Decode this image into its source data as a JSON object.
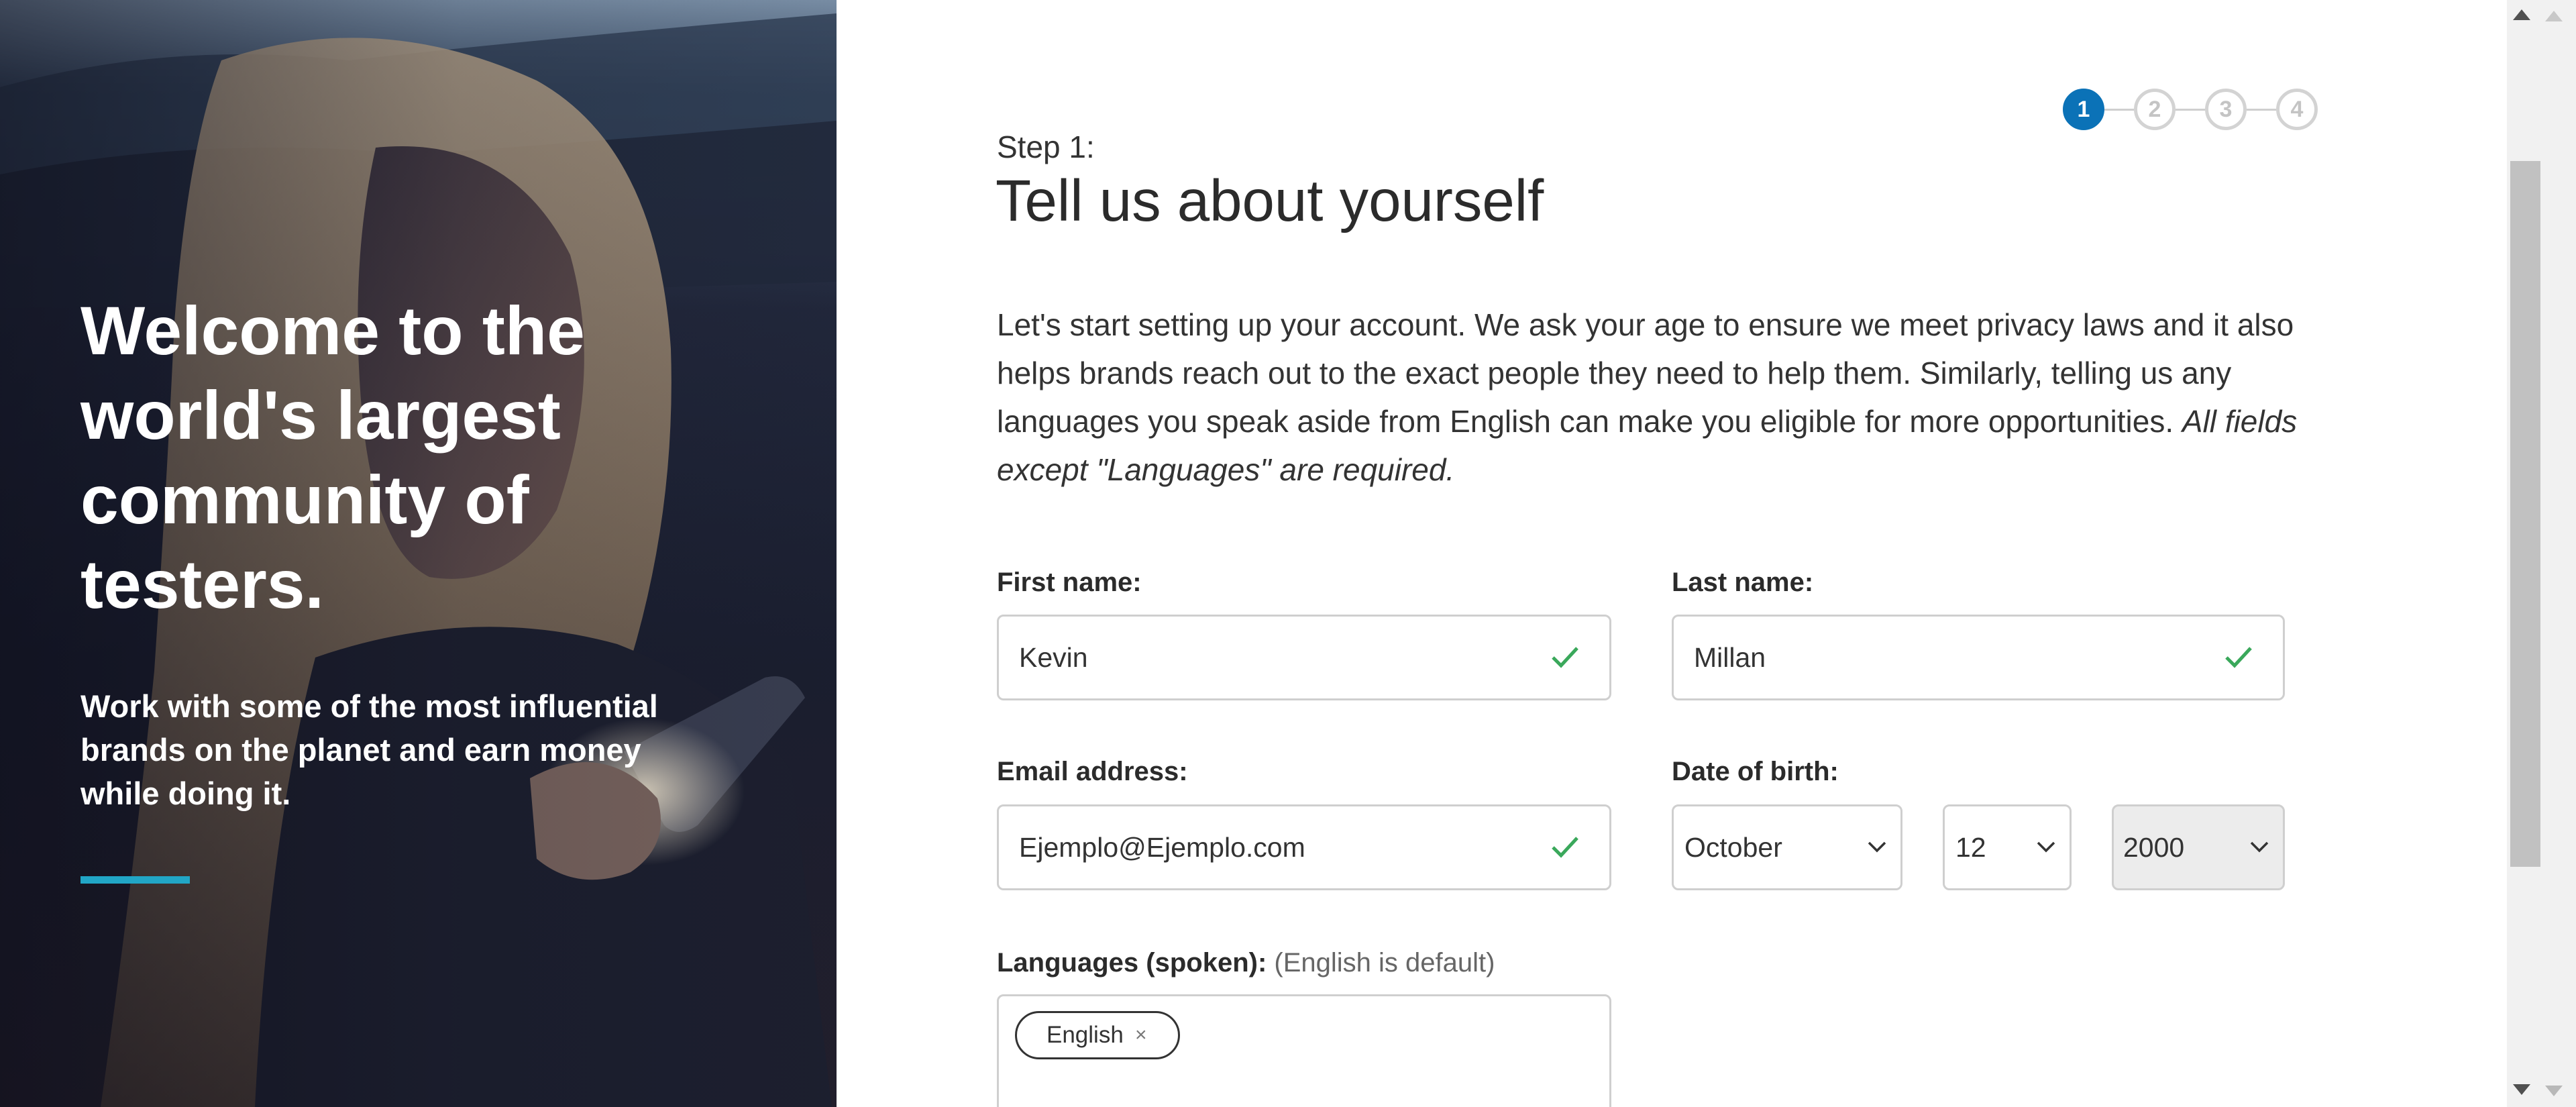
{
  "hero": {
    "title": "Welcome to the world's largest community of testers.",
    "subtitle": "Work with some of the most influential brands on the planet and earn money while doing it.",
    "accent_color": "#21a6c6"
  },
  "stepper": {
    "steps": [
      "1",
      "2",
      "3",
      "4"
    ],
    "active_step": "1",
    "active_color": "#0b72b7"
  },
  "form": {
    "step_label": "Step 1:",
    "title": "Tell us about yourself",
    "intro_text": "Let's start setting up your account. We ask your age to ensure we meet privacy laws and it also helps brands reach out to the exact people they need to help them. Similarly, telling us any languages you speak aside from English can make you eligible for more opportunities. ",
    "intro_note": "All fields except \"Languages\" are required.",
    "first_name": {
      "label": "First name:",
      "value": "Kevin",
      "valid_icon": "check-icon"
    },
    "last_name": {
      "label": "Last name:",
      "value": "Millan",
      "valid_icon": "check-icon"
    },
    "email": {
      "label": "Email address:",
      "value": "Ejemplo@Ejemplo.com",
      "valid_icon": "check-icon"
    },
    "dob": {
      "label": "Date of birth:",
      "month": "October",
      "day": "12",
      "year": "2000"
    },
    "languages": {
      "label": "Languages (spoken):",
      "note": "(English is default)",
      "chips": [
        {
          "label": "English",
          "remove_glyph": "×"
        }
      ]
    },
    "valid_color": "#3aa85b"
  }
}
